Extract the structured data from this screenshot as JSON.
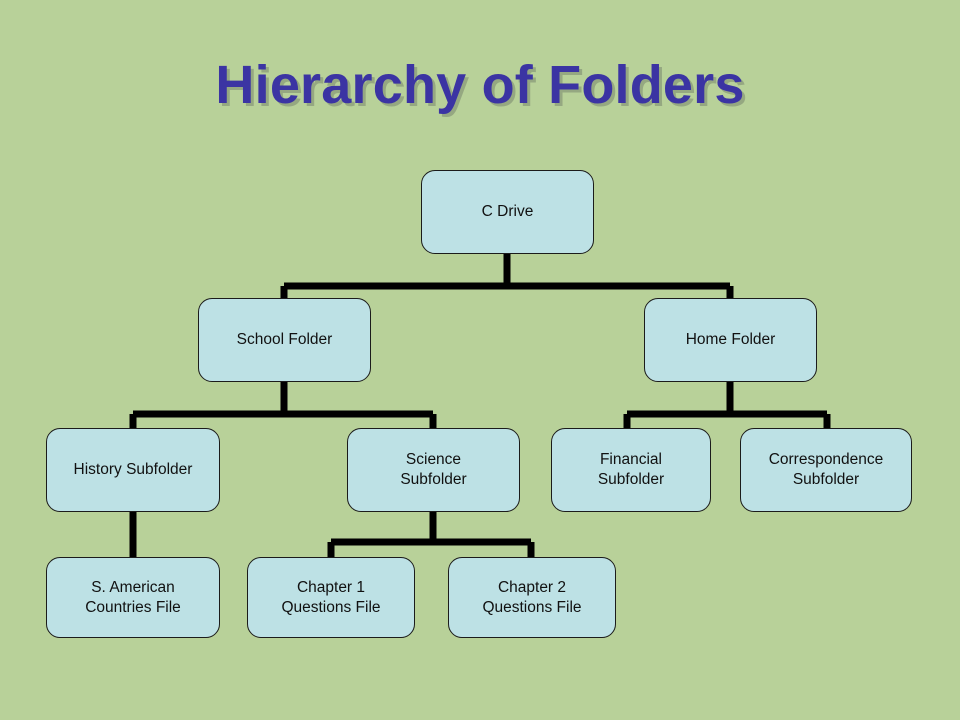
{
  "slide": {
    "title": "Hierarchy of Folders",
    "background_color": "#b8d199",
    "title_color": "#3b34a3",
    "node_fill_color": "#bde1e5",
    "node_border_color": "#1b1b1b",
    "connector_color": "#000000"
  },
  "nodes": {
    "c_drive": {
      "label": "C Drive"
    },
    "school_folder": {
      "label": "School Folder"
    },
    "home_folder": {
      "label": "Home Folder"
    },
    "history_subfolder": {
      "label": "History Subfolder"
    },
    "science_subfolder": {
      "label": "Science\nSubfolder"
    },
    "financial_subfolder": {
      "label": "Financial\nSubfolder"
    },
    "correspondence_subfolder": {
      "label": "Correspondence\nSubfolder"
    },
    "s_american_countries_file": {
      "label": "S. American\nCountries File"
    },
    "chapter1_questions_file": {
      "label": "Chapter 1\nQuestions File"
    },
    "chapter2_questions_file": {
      "label": "Chapter 2\nQuestions File"
    }
  },
  "hierarchy": [
    {
      "parent": "C Drive",
      "children": [
        "School Folder",
        "Home Folder"
      ]
    },
    {
      "parent": "School Folder",
      "children": [
        "History Subfolder",
        "Science Subfolder"
      ]
    },
    {
      "parent": "Home Folder",
      "children": [
        "Financial Subfolder",
        "Correspondence Subfolder"
      ]
    },
    {
      "parent": "History Subfolder",
      "children": [
        "S. American Countries File"
      ]
    },
    {
      "parent": "Science Subfolder",
      "children": [
        "Chapter 1 Questions File",
        "Chapter 2 Questions File"
      ]
    }
  ]
}
